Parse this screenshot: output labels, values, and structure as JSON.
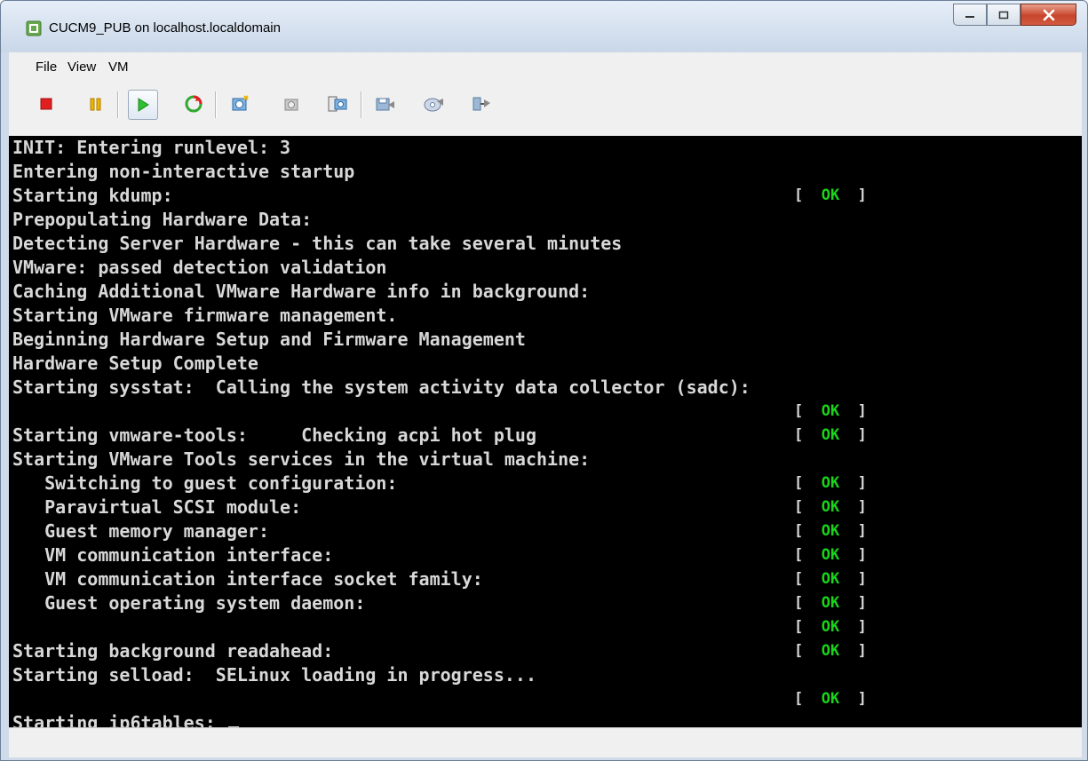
{
  "window": {
    "title": "CUCM9_PUB on localhost.localdomain"
  },
  "menu": [
    "File",
    "View",
    "VM"
  ],
  "toolbar": {
    "buttons": [
      "power-off-icon",
      "suspend-icon",
      "power-on-icon",
      "reset-icon",
      "take-snapshot-icon",
      "revert-snapshot-icon",
      "snapshot-manager-icon",
      "connect-floppy-icon",
      "connect-cdrom-icon",
      "connect-network-icon"
    ]
  },
  "colors": {
    "console_bg": "#000000",
    "console_text": "#d8d8d8",
    "ok_green": "#19d619"
  },
  "console": {
    "lines": [
      {
        "text": "INIT: Entering runlevel: 3",
        "ok": false
      },
      {
        "text": "Entering non-interactive startup",
        "ok": false
      },
      {
        "text": "Starting kdump:",
        "ok": true
      },
      {
        "text": "Prepopulating Hardware Data:",
        "ok": false
      },
      {
        "text": "Detecting Server Hardware - this can take several minutes",
        "ok": false
      },
      {
        "text": "VMware: passed detection validation",
        "ok": false
      },
      {
        "text": "Caching Additional VMware Hardware info in background:",
        "ok": false
      },
      {
        "text": "Starting VMware firmware management.",
        "ok": false
      },
      {
        "text": "Beginning Hardware Setup and Firmware Management",
        "ok": false
      },
      {
        "text": "Hardware Setup Complete",
        "ok": false
      },
      {
        "text": "Starting sysstat:  Calling the system activity data collector (sadc):",
        "ok": false
      },
      {
        "text": "",
        "ok": true
      },
      {
        "text": "Starting vmware-tools:     Checking acpi hot plug",
        "ok": true
      },
      {
        "text": "Starting VMware Tools services in the virtual machine:",
        "ok": false
      },
      {
        "text": "   Switching to guest configuration:",
        "ok": true
      },
      {
        "text": "   Paravirtual SCSI module:",
        "ok": true
      },
      {
        "text": "   Guest memory manager:",
        "ok": true
      },
      {
        "text": "   VM communication interface:",
        "ok": true
      },
      {
        "text": "   VM communication interface socket family:",
        "ok": true
      },
      {
        "text": "   Guest operating system daemon:",
        "ok": true
      },
      {
        "text": "",
        "ok": true
      },
      {
        "text": "Starting background readahead:",
        "ok": true
      },
      {
        "text": "Starting selload:  SELinux loading in progress...",
        "ok": false
      },
      {
        "text": "",
        "ok": true
      },
      {
        "text": "Starting ip6tables: ",
        "ok": false,
        "cursor": true
      }
    ],
    "ok_label": "OK",
    "ok_open": "[",
    "ok_close": "]"
  }
}
